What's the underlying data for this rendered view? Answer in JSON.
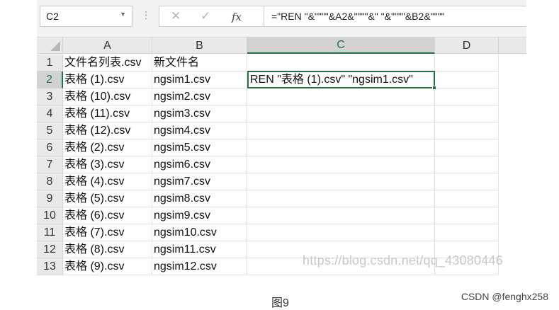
{
  "formula_bar": {
    "name_box": "C2",
    "separator": "⋮",
    "cancel_symbol": "✕",
    "enter_symbol": "✓",
    "fx_symbol": "fx",
    "formula": "=\"REN \"&\"\"\"\"&A2&\"\"\"\"&\" \"&\"\"\"\"&B2&\"\"\"\""
  },
  "columns": [
    "A",
    "B",
    "C",
    "D"
  ],
  "rows": [
    {
      "n": "1",
      "a": "文件名列表.csv",
      "b": "新文件名",
      "c": ""
    },
    {
      "n": "2",
      "a": "表格 (1).csv",
      "b": "ngsim1.csv",
      "c": "REN \"表格 (1).csv\" \"ngsim1.csv\""
    },
    {
      "n": "3",
      "a": "表格 (10).csv",
      "b": "ngsim2.csv",
      "c": ""
    },
    {
      "n": "4",
      "a": "表格 (11).csv",
      "b": "ngsim3.csv",
      "c": ""
    },
    {
      "n": "5",
      "a": "表格 (12).csv",
      "b": "ngsim4.csv",
      "c": ""
    },
    {
      "n": "6",
      "a": "表格 (2).csv",
      "b": "ngsim5.csv",
      "c": ""
    },
    {
      "n": "7",
      "a": "表格 (3).csv",
      "b": "ngsim6.csv",
      "c": ""
    },
    {
      "n": "8",
      "a": "表格 (4).csv",
      "b": "ngsim7.csv",
      "c": ""
    },
    {
      "n": "9",
      "a": "表格 (5).csv",
      "b": "ngsim8.csv",
      "c": ""
    },
    {
      "n": "10",
      "a": "表格 (6).csv",
      "b": "ngsim9.csv",
      "c": ""
    },
    {
      "n": "11",
      "a": "表格 (7).csv",
      "b": "ngsim10.csv",
      "c": ""
    },
    {
      "n": "12",
      "a": "表格 (8).csv",
      "b": "ngsim11.csv",
      "c": ""
    },
    {
      "n": "13",
      "a": "表格 (9).csv",
      "b": "ngsim12.csv",
      "c": ""
    }
  ],
  "watermark": "https://blog.csdn.net/qq_43080446",
  "caption": "图9",
  "credit": "CSDN @fenghx258",
  "colors": {
    "accent": "#217346"
  }
}
